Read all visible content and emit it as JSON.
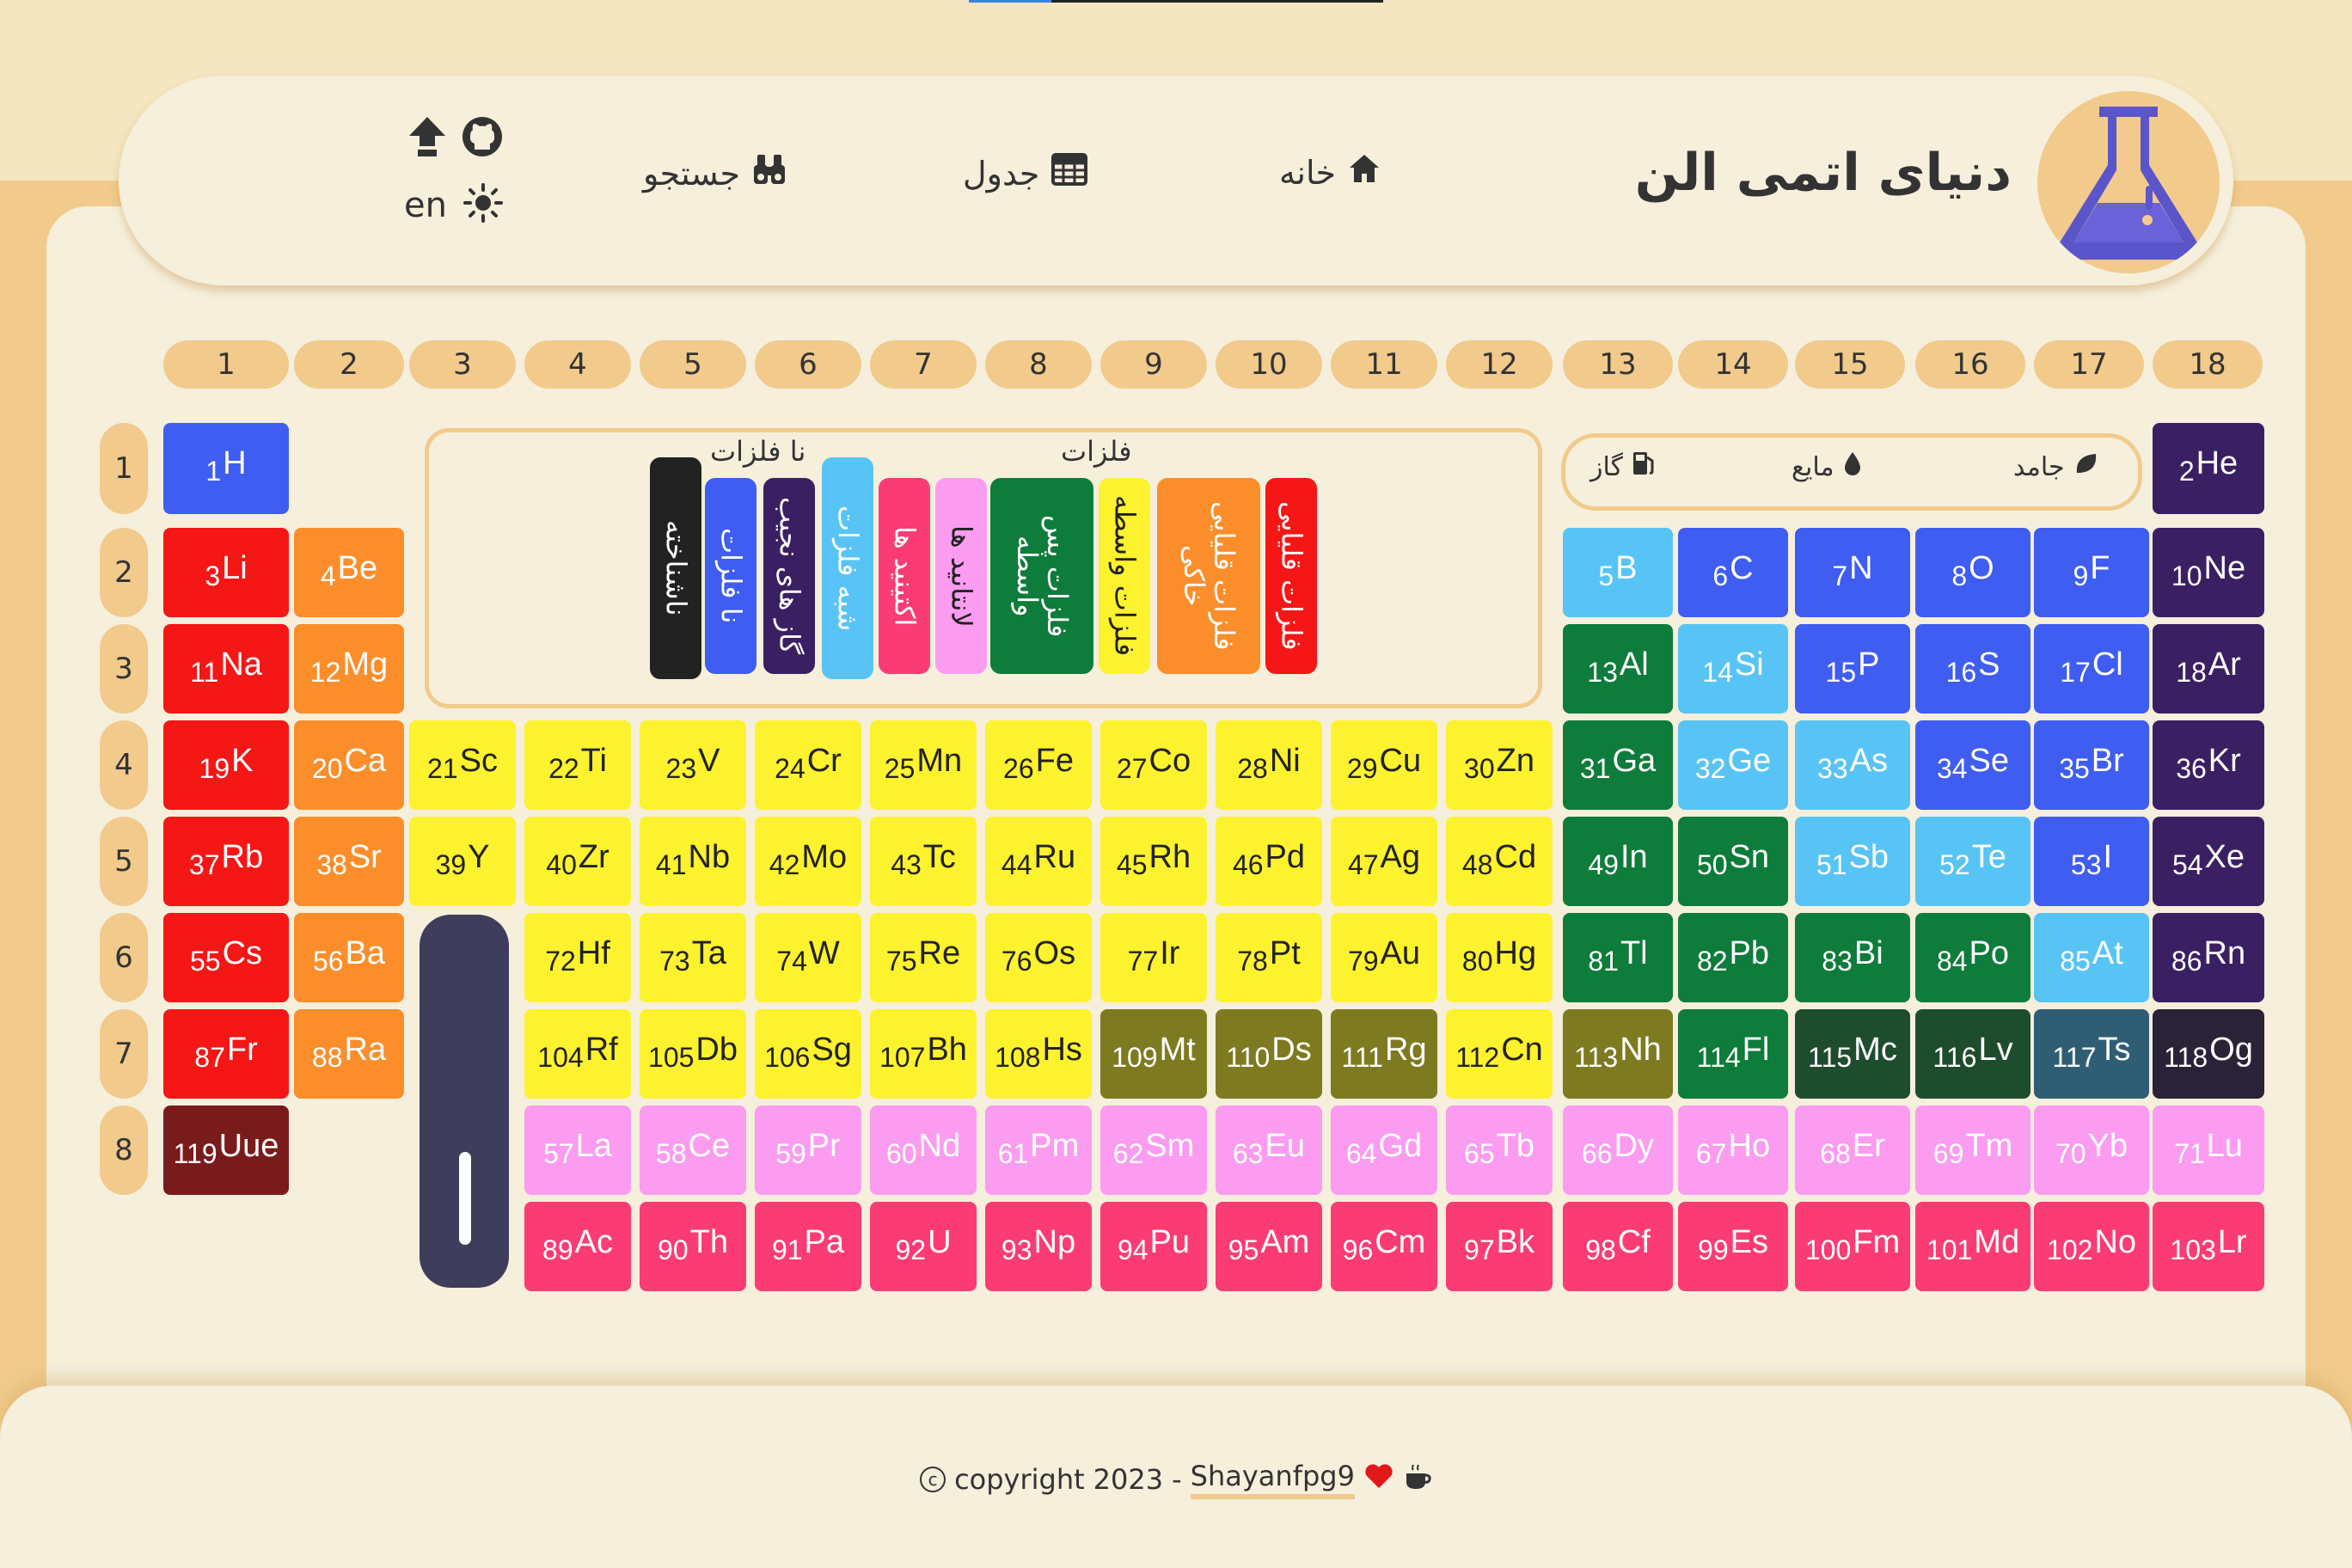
{
  "app": {
    "title": "دنیای اتمی الن"
  },
  "nav": {
    "home": "خانه",
    "table": "جدول",
    "search": "جستجو",
    "lang": "en"
  },
  "groups": [
    "1",
    "2",
    "3",
    "4",
    "5",
    "6",
    "7",
    "8",
    "9",
    "10",
    "11",
    "12",
    "13",
    "14",
    "15",
    "16",
    "17",
    "18"
  ],
  "periods": [
    "1",
    "2",
    "3",
    "4",
    "5",
    "6",
    "7",
    "8"
  ],
  "legend": {
    "metals_title": "فلزات",
    "nonmetals_title": "نا فلزات",
    "categories": [
      "فلزات قلیایی",
      "فلزات قلیایی خاکی",
      "فلزات واسطه",
      "فلزات پس واسطه",
      "لانتانید ها",
      "اکتینید ها",
      "شبه فلزات",
      "گاز های نجیب",
      "نا فلزات",
      "ناشناخته"
    ]
  },
  "states": {
    "solid": "جامد",
    "liquid": "مایع",
    "gas": "گاز"
  },
  "colors": {
    "alkali": "#f51616",
    "alkaline": "#fb8e2b",
    "transition": "#fdf22e",
    "posttransition": "#0e7c3a",
    "lanthanide": "#fb9cf0",
    "actinide": "#fb3c74",
    "metalloid": "#58c4f5",
    "noble": "#3a1f63",
    "nonmetal": "#3f5df0",
    "unknown": "#222222"
  },
  "elements": [
    {
      "n": "1",
      "s": "H",
      "r": 1,
      "c": 1,
      "t": "nonmetal"
    },
    {
      "n": "2",
      "s": "He",
      "r": 1,
      "c": 18,
      "t": "noble"
    },
    {
      "n": "3",
      "s": "Li",
      "r": 2,
      "c": 1,
      "t": "alkali"
    },
    {
      "n": "4",
      "s": "Be",
      "r": 2,
      "c": 2,
      "t": "alkaline"
    },
    {
      "n": "5",
      "s": "B",
      "r": 2,
      "c": 13,
      "t": "metalloid"
    },
    {
      "n": "6",
      "s": "C",
      "r": 2,
      "c": 14,
      "t": "nonmetal"
    },
    {
      "n": "7",
      "s": "N",
      "r": 2,
      "c": 15,
      "t": "nonmetal"
    },
    {
      "n": "8",
      "s": "O",
      "r": 2,
      "c": 16,
      "t": "nonmetal"
    },
    {
      "n": "9",
      "s": "F",
      "r": 2,
      "c": 17,
      "t": "nonmetal"
    },
    {
      "n": "10",
      "s": "Ne",
      "r": 2,
      "c": 18,
      "t": "noble"
    },
    {
      "n": "11",
      "s": "Na",
      "r": 3,
      "c": 1,
      "t": "alkali"
    },
    {
      "n": "12",
      "s": "Mg",
      "r": 3,
      "c": 2,
      "t": "alkaline"
    },
    {
      "n": "13",
      "s": "Al",
      "r": 3,
      "c": 13,
      "t": "posttransition"
    },
    {
      "n": "14",
      "s": "Si",
      "r": 3,
      "c": 14,
      "t": "metalloid"
    },
    {
      "n": "15",
      "s": "P",
      "r": 3,
      "c": 15,
      "t": "nonmetal"
    },
    {
      "n": "16",
      "s": "S",
      "r": 3,
      "c": 16,
      "t": "nonmetal"
    },
    {
      "n": "17",
      "s": "Cl",
      "r": 3,
      "c": 17,
      "t": "nonmetal"
    },
    {
      "n": "18",
      "s": "Ar",
      "r": 3,
      "c": 18,
      "t": "noble"
    },
    {
      "n": "19",
      "s": "K",
      "r": 4,
      "c": 1,
      "t": "alkali"
    },
    {
      "n": "20",
      "s": "Ca",
      "r": 4,
      "c": 2,
      "t": "alkaline"
    },
    {
      "n": "21",
      "s": "Sc",
      "r": 4,
      "c": 3,
      "t": "transition"
    },
    {
      "n": "22",
      "s": "Ti",
      "r": 4,
      "c": 4,
      "t": "transition"
    },
    {
      "n": "23",
      "s": "V",
      "r": 4,
      "c": 5,
      "t": "transition"
    },
    {
      "n": "24",
      "s": "Cr",
      "r": 4,
      "c": 6,
      "t": "transition"
    },
    {
      "n": "25",
      "s": "Mn",
      "r": 4,
      "c": 7,
      "t": "transition"
    },
    {
      "n": "26",
      "s": "Fe",
      "r": 4,
      "c": 8,
      "t": "transition"
    },
    {
      "n": "27",
      "s": "Co",
      "r": 4,
      "c": 9,
      "t": "transition"
    },
    {
      "n": "28",
      "s": "Ni",
      "r": 4,
      "c": 10,
      "t": "transition"
    },
    {
      "n": "29",
      "s": "Cu",
      "r": 4,
      "c": 11,
      "t": "transition"
    },
    {
      "n": "30",
      "s": "Zn",
      "r": 4,
      "c": 12,
      "t": "transition"
    },
    {
      "n": "31",
      "s": "Ga",
      "r": 4,
      "c": 13,
      "t": "posttransition"
    },
    {
      "n": "32",
      "s": "Ge",
      "r": 4,
      "c": 14,
      "t": "metalloid"
    },
    {
      "n": "33",
      "s": "As",
      "r": 4,
      "c": 15,
      "t": "metalloid"
    },
    {
      "n": "34",
      "s": "Se",
      "r": 4,
      "c": 16,
      "t": "nonmetal"
    },
    {
      "n": "35",
      "s": "Br",
      "r": 4,
      "c": 17,
      "t": "nonmetal"
    },
    {
      "n": "36",
      "s": "Kr",
      "r": 4,
      "c": 18,
      "t": "noble"
    },
    {
      "n": "37",
      "s": "Rb",
      "r": 5,
      "c": 1,
      "t": "alkali"
    },
    {
      "n": "38",
      "s": "Sr",
      "r": 5,
      "c": 2,
      "t": "alkaline"
    },
    {
      "n": "39",
      "s": "Y",
      "r": 5,
      "c": 3,
      "t": "transition"
    },
    {
      "n": "40",
      "s": "Zr",
      "r": 5,
      "c": 4,
      "t": "transition"
    },
    {
      "n": "41",
      "s": "Nb",
      "r": 5,
      "c": 5,
      "t": "transition"
    },
    {
      "n": "42",
      "s": "Mo",
      "r": 5,
      "c": 6,
      "t": "transition"
    },
    {
      "n": "43",
      "s": "Tc",
      "r": 5,
      "c": 7,
      "t": "transition"
    },
    {
      "n": "44",
      "s": "Ru",
      "r": 5,
      "c": 8,
      "t": "transition"
    },
    {
      "n": "45",
      "s": "Rh",
      "r": 5,
      "c": 9,
      "t": "transition"
    },
    {
      "n": "46",
      "s": "Pd",
      "r": 5,
      "c": 10,
      "t": "transition"
    },
    {
      "n": "47",
      "s": "Ag",
      "r": 5,
      "c": 11,
      "t": "transition"
    },
    {
      "n": "48",
      "s": "Cd",
      "r": 5,
      "c": 12,
      "t": "transition"
    },
    {
      "n": "49",
      "s": "In",
      "r": 5,
      "c": 13,
      "t": "posttransition"
    },
    {
      "n": "50",
      "s": "Sn",
      "r": 5,
      "c": 14,
      "t": "posttransition"
    },
    {
      "n": "51",
      "s": "Sb",
      "r": 5,
      "c": 15,
      "t": "metalloid"
    },
    {
      "n": "52",
      "s": "Te",
      "r": 5,
      "c": 16,
      "t": "metalloid"
    },
    {
      "n": "53",
      "s": "I",
      "r": 5,
      "c": 17,
      "t": "nonmetal"
    },
    {
      "n": "54",
      "s": "Xe",
      "r": 5,
      "c": 18,
      "t": "noble"
    },
    {
      "n": "55",
      "s": "Cs",
      "r": 6,
      "c": 1,
      "t": "alkali"
    },
    {
      "n": "56",
      "s": "Ba",
      "r": 6,
      "c": 2,
      "t": "alkaline"
    },
    {
      "n": "72",
      "s": "Hf",
      "r": 6,
      "c": 4,
      "t": "transition"
    },
    {
      "n": "73",
      "s": "Ta",
      "r": 6,
      "c": 5,
      "t": "transition"
    },
    {
      "n": "74",
      "s": "W",
      "r": 6,
      "c": 6,
      "t": "transition"
    },
    {
      "n": "75",
      "s": "Re",
      "r": 6,
      "c": 7,
      "t": "transition"
    },
    {
      "n": "76",
      "s": "Os",
      "r": 6,
      "c": 8,
      "t": "transition"
    },
    {
      "n": "77",
      "s": "Ir",
      "r": 6,
      "c": 9,
      "t": "transition"
    },
    {
      "n": "78",
      "s": "Pt",
      "r": 6,
      "c": 10,
      "t": "transition"
    },
    {
      "n": "79",
      "s": "Au",
      "r": 6,
      "c": 11,
      "t": "transition"
    },
    {
      "n": "80",
      "s": "Hg",
      "r": 6,
      "c": 12,
      "t": "transition"
    },
    {
      "n": "81",
      "s": "Tl",
      "r": 6,
      "c": 13,
      "t": "posttransition"
    },
    {
      "n": "82",
      "s": "Pb",
      "r": 6,
      "c": 14,
      "t": "posttransition"
    },
    {
      "n": "83",
      "s": "Bi",
      "r": 6,
      "c": 15,
      "t": "posttransition"
    },
    {
      "n": "84",
      "s": "Po",
      "r": 6,
      "c": 16,
      "t": "posttransition"
    },
    {
      "n": "85",
      "s": "At",
      "r": 6,
      "c": 17,
      "t": "metalloid"
    },
    {
      "n": "86",
      "s": "Rn",
      "r": 6,
      "c": 18,
      "t": "noble"
    },
    {
      "n": "87",
      "s": "Fr",
      "r": 7,
      "c": 1,
      "t": "alkali"
    },
    {
      "n": "88",
      "s": "Ra",
      "r": 7,
      "c": 2,
      "t": "alkaline"
    },
    {
      "n": "104",
      "s": "Rf",
      "r": 7,
      "c": 4,
      "t": "transition"
    },
    {
      "n": "105",
      "s": "Db",
      "r": 7,
      "c": 5,
      "t": "transition"
    },
    {
      "n": "106",
      "s": "Sg",
      "r": 7,
      "c": 6,
      "t": "transition"
    },
    {
      "n": "107",
      "s": "Bh",
      "r": 7,
      "c": 7,
      "t": "transition"
    },
    {
      "n": "108",
      "s": "Hs",
      "r": 7,
      "c": 8,
      "t": "transition"
    },
    {
      "n": "109",
      "s": "Mt",
      "r": 7,
      "c": 9,
      "t": "unknownT"
    },
    {
      "n": "110",
      "s": "Ds",
      "r": 7,
      "c": 10,
      "t": "unknownT"
    },
    {
      "n": "111",
      "s": "Rg",
      "r": 7,
      "c": 11,
      "t": "unknownT"
    },
    {
      "n": "112",
      "s": "Cn",
      "r": 7,
      "c": 12,
      "t": "transition"
    },
    {
      "n": "113",
      "s": "Nh",
      "r": 7,
      "c": 13,
      "t": "unknownT"
    },
    {
      "n": "114",
      "s": "Fl",
      "r": 7,
      "c": 14,
      "t": "posttransition"
    },
    {
      "n": "115",
      "s": "Mc",
      "r": 7,
      "c": 15,
      "t": "unknownP"
    },
    {
      "n": "116",
      "s": "Lv",
      "r": 7,
      "c": 16,
      "t": "unknownP"
    },
    {
      "n": "117",
      "s": "Ts",
      "r": 7,
      "c": 17,
      "t": "unknownM"
    },
    {
      "n": "118",
      "s": "Og",
      "r": 7,
      "c": 18,
      "t": "unknownN"
    },
    {
      "n": "119",
      "s": "Uue",
      "r": 8,
      "c": 1,
      "t": "unknownA"
    },
    {
      "n": "57",
      "s": "La",
      "r": 8,
      "c": 4,
      "t": "lanthanide"
    },
    {
      "n": "58",
      "s": "Ce",
      "r": 8,
      "c": 5,
      "t": "lanthanide"
    },
    {
      "n": "59",
      "s": "Pr",
      "r": 8,
      "c": 6,
      "t": "lanthanide"
    },
    {
      "n": "60",
      "s": "Nd",
      "r": 8,
      "c": 7,
      "t": "lanthanide"
    },
    {
      "n": "61",
      "s": "Pm",
      "r": 8,
      "c": 8,
      "t": "lanthanide"
    },
    {
      "n": "62",
      "s": "Sm",
      "r": 8,
      "c": 9,
      "t": "lanthanide"
    },
    {
      "n": "63",
      "s": "Eu",
      "r": 8,
      "c": 10,
      "t": "lanthanide"
    },
    {
      "n": "64",
      "s": "Gd",
      "r": 8,
      "c": 11,
      "t": "lanthanide"
    },
    {
      "n": "65",
      "s": "Tb",
      "r": 8,
      "c": 12,
      "t": "lanthanide"
    },
    {
      "n": "66",
      "s": "Dy",
      "r": 8,
      "c": 13,
      "t": "lanthanide"
    },
    {
      "n": "67",
      "s": "Ho",
      "r": 8,
      "c": 14,
      "t": "lanthanide"
    },
    {
      "n": "68",
      "s": "Er",
      "r": 8,
      "c": 15,
      "t": "lanthanide"
    },
    {
      "n": "69",
      "s": "Tm",
      "r": 8,
      "c": 16,
      "t": "lanthanide"
    },
    {
      "n": "70",
      "s": "Yb",
      "r": 8,
      "c": 17,
      "t": "lanthanide"
    },
    {
      "n": "71",
      "s": "Lu",
      "r": 8,
      "c": 18,
      "t": "lanthanide"
    },
    {
      "n": "89",
      "s": "Ac",
      "r": 9,
      "c": 4,
      "t": "actinide"
    },
    {
      "n": "90",
      "s": "Th",
      "r": 9,
      "c": 5,
      "t": "actinide"
    },
    {
      "n": "91",
      "s": "Pa",
      "r": 9,
      "c": 6,
      "t": "actinide"
    },
    {
      "n": "92",
      "s": "U",
      "r": 9,
      "c": 7,
      "t": "actinide"
    },
    {
      "n": "93",
      "s": "Np",
      "r": 9,
      "c": 8,
      "t": "actinide"
    },
    {
      "n": "94",
      "s": "Pu",
      "r": 9,
      "c": 9,
      "t": "actinide"
    },
    {
      "n": "95",
      "s": "Am",
      "r": 9,
      "c": 10,
      "t": "actinide"
    },
    {
      "n": "96",
      "s": "Cm",
      "r": 9,
      "c": 11,
      "t": "actinide"
    },
    {
      "n": "97",
      "s": "Bk",
      "r": 9,
      "c": 12,
      "t": "actinide"
    },
    {
      "n": "98",
      "s": "Cf",
      "r": 9,
      "c": 13,
      "t": "actinide"
    },
    {
      "n": "99",
      "s": "Es",
      "r": 9,
      "c": 14,
      "t": "actinide"
    },
    {
      "n": "100",
      "s": "Fm",
      "r": 9,
      "c": 15,
      "t": "actinide"
    },
    {
      "n": "101",
      "s": "Md",
      "r": 9,
      "c": 16,
      "t": "actinide"
    },
    {
      "n": "102",
      "s": "No",
      "r": 9,
      "c": 17,
      "t": "actinide"
    },
    {
      "n": "103",
      "s": "Lr",
      "r": 9,
      "c": 18,
      "t": "actinide"
    }
  ],
  "footer": {
    "copyright": "copyright",
    "year": "2023",
    "sep": "-",
    "author": "Shayanfpg9"
  }
}
